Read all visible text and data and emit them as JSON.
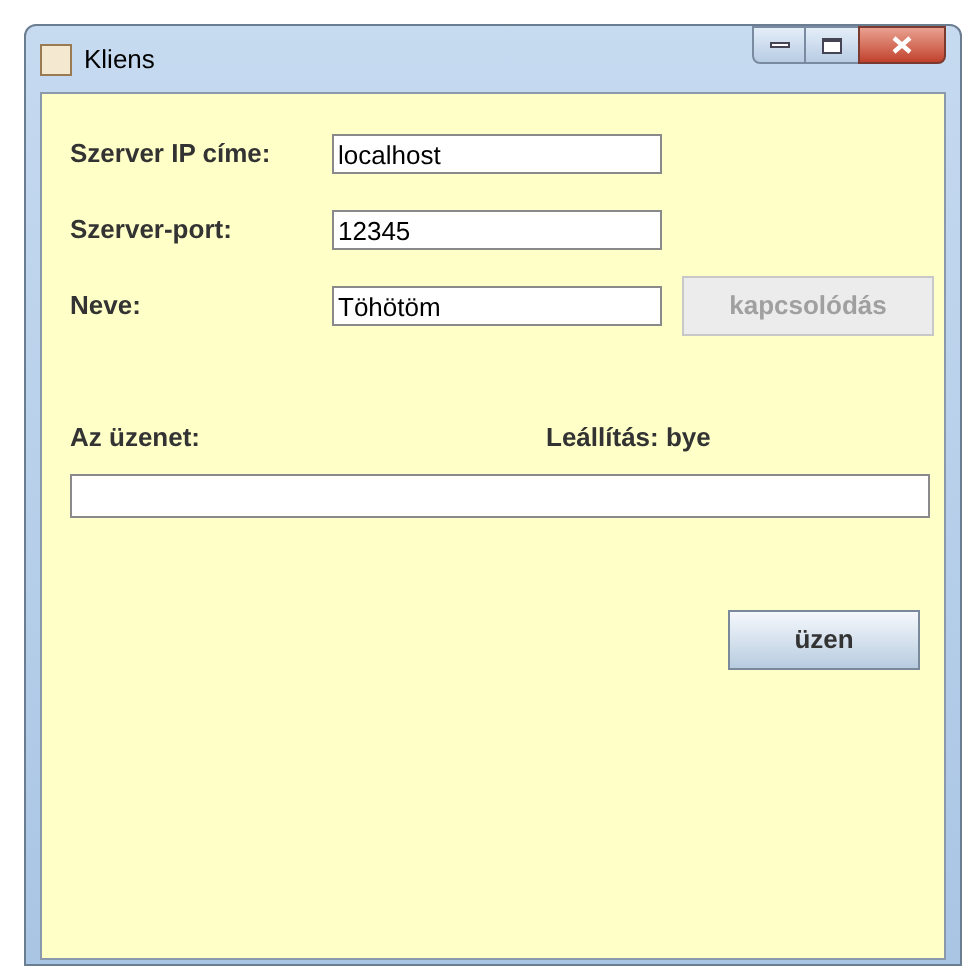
{
  "window": {
    "title": "Kliens"
  },
  "fields": [
    {
      "label": "Szerver IP címe:",
      "value": "localhost"
    },
    {
      "label": "Szerver-port:",
      "value": "12345"
    },
    {
      "label": "Neve:",
      "value": "Töhötöm"
    }
  ],
  "connect_button": {
    "label": "kapcsolódás",
    "disabled": true
  },
  "message": {
    "label": "Az üzenet:",
    "hint": "Leállítás: bye"
  },
  "send_button": {
    "label": "üzen",
    "disabled": false
  }
}
